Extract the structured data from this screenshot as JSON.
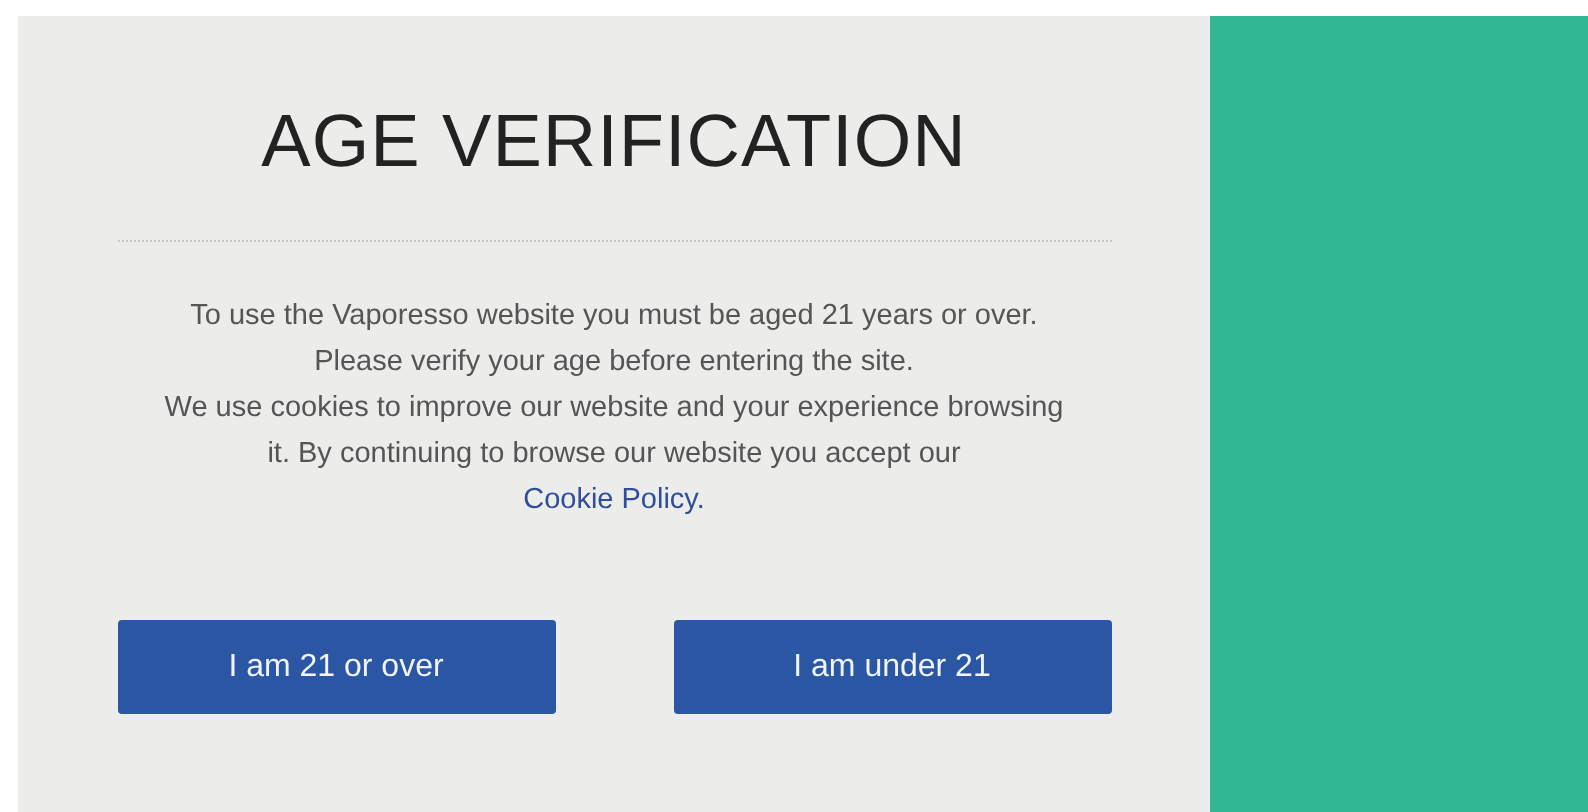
{
  "dialog": {
    "title": "AGE VERIFICATION",
    "message": "To use the Vaporesso website you must be aged 21 years or over. Please verify your age before entering the site.",
    "cookie_notice": {
      "text": "We use cookies to improve our website and your experience browsing it. By continuing to browse our website you accept our",
      "link": "Cookie Policy."
    },
    "buttons": [
      "I am 21 or over",
      "I am under 21"
    ]
  }
}
